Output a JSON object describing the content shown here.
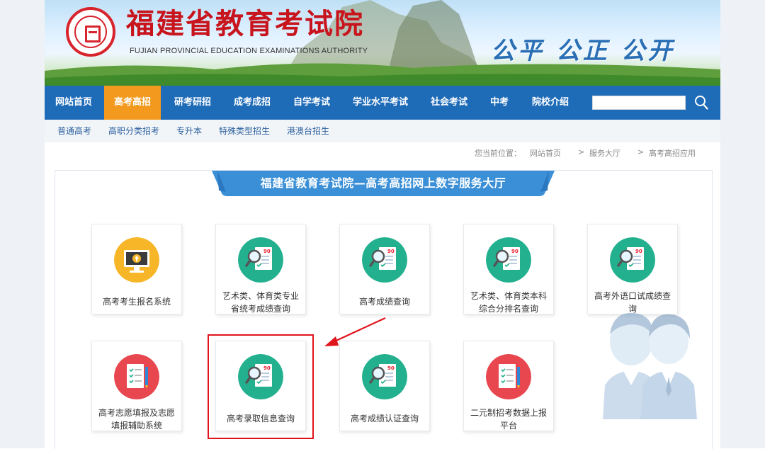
{
  "header": {
    "title_cn": "福建省教育考试院",
    "title_en": "FUJIAN PROVINCIAL EDUCATION EXAMINATIONS AUTHORITY",
    "slogan": "公平 公正 公开"
  },
  "nav": {
    "items": [
      {
        "label": "网站首页"
      },
      {
        "label": "高考高招",
        "active": true
      },
      {
        "label": "研考研招"
      },
      {
        "label": "成考成招"
      },
      {
        "label": "自学考试"
      },
      {
        "label": "学业水平考试"
      },
      {
        "label": "社会考试"
      },
      {
        "label": "中考"
      },
      {
        "label": "院校介绍"
      }
    ],
    "search_value": ""
  },
  "subnav": {
    "items": [
      "普通高考",
      "高职分类招考",
      "专升本",
      "特殊类型招生",
      "港澳台招生"
    ]
  },
  "breadcrumb": {
    "prefix": "您当前位置：",
    "items": [
      "网站首页",
      "服务大厅",
      "高考高招应用"
    ],
    "separator": ">"
  },
  "panel": {
    "banner": "福建省教育考试院—高考高招网上数字服务大厅",
    "cards": [
      {
        "label": "高考考生报名系统",
        "icon": "computer-upload-icon",
        "color": "#f6b628"
      },
      {
        "label": "艺术类、体育类专业省统考成绩查询",
        "icon": "score-search-icon",
        "color": "#23b08f"
      },
      {
        "label": "高考成绩查询",
        "icon": "score-search-icon",
        "color": "#23b08f"
      },
      {
        "label": "艺术类、体育类本科综合分排名查询",
        "icon": "score-search-icon",
        "color": "#23b08f"
      },
      {
        "label": "高考外语口试成绩查询",
        "icon": "score-search-icon",
        "color": "#23b08f"
      },
      {
        "label": "高考志愿填报及志愿填报辅助系统",
        "icon": "checklist-icon",
        "color": "#e8474f"
      },
      {
        "label": "高考录取信息查询",
        "icon": "score-search-icon",
        "color": "#23b08f",
        "highlighted": true
      },
      {
        "label": "高考成绩认证查询",
        "icon": "score-search-icon",
        "color": "#23b08f"
      },
      {
        "label": "二元制招考数据上报平台",
        "icon": "checklist-icon",
        "color": "#e8474f"
      }
    ]
  },
  "colors": {
    "nav_bg": "#1e6bb8",
    "nav_active": "#f39a1e",
    "banner": "#3a8fd6",
    "highlight": "#e0141c"
  }
}
